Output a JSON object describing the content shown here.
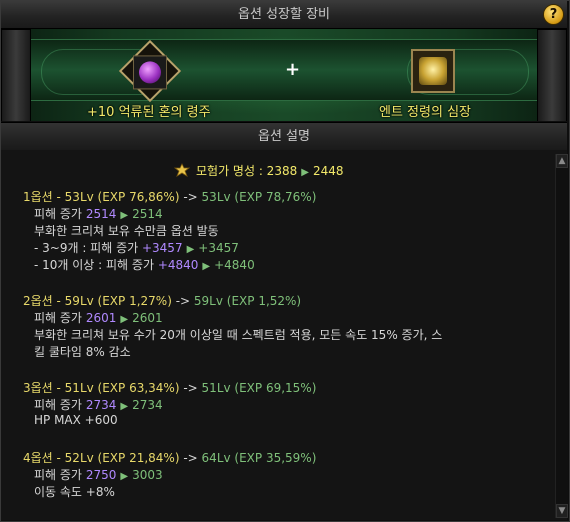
{
  "title": "옵션 성장할 장비",
  "help_label": "?",
  "banner": {
    "left_item": "+10 억류된 혼의 령주",
    "right_item": "엔트 정령의 심장",
    "plus": "+"
  },
  "section_title": "옵션 설명",
  "fame": {
    "label": "모험가 명성 : 2388",
    "to": "2448"
  },
  "options": [
    {
      "header_pre": "1옵션 - 53Lv (EXP 76,86%) ",
      "header_arrow": "->",
      "header_post": " 53Lv (EXP 78,76%)",
      "damage_label": "피해 증가",
      "damage_from": "2514",
      "damage_to": "2514",
      "extra": [
        "부화한 크리쳐 보유 수만큼 옵션 발동",
        "- 3~9개 : 피해 증가 "
      ],
      "sub1_from": "+3457",
      "sub1_to": "+3457",
      "sub2_label": "- 10개 이상 : 피해 증가 ",
      "sub2_from": "+4840",
      "sub2_to": "+4840"
    },
    {
      "header_pre": "2옵션 - 59Lv (EXP 1,27%) ",
      "header_arrow": "->",
      "header_post": " 59Lv (EXP 1,52%)",
      "damage_label": "피해 증가",
      "damage_from": "2601",
      "damage_to": "2601",
      "extra_line1": "부화한 크리쳐 보유 수가 20개 이상일 때 스펙트럼 적용, 모든 속도 15% 증가, 스",
      "extra_line2": "킬 쿨타임 8% 감소"
    },
    {
      "header_pre": "3옵션 - 51Lv (EXP 63,34%) ",
      "header_arrow": "->",
      "header_post": " 51Lv (EXP 69,15%)",
      "damage_label": "피해 증가",
      "damage_from": "2734",
      "damage_to": "2734",
      "extra_line1": "HP MAX +600"
    },
    {
      "header_pre": "4옵션 - 52Lv (EXP 21,84%) ",
      "header_arrow": "->",
      "header_post": " 64Lv (EXP 35,59%)",
      "damage_label": "피해 증가",
      "damage_from": "2750",
      "damage_to": "3003",
      "extra_line1": "이동 속도 +8%"
    }
  ],
  "arrow_glyph": "▶",
  "colors": {
    "accent_yellow": "#e8d96a",
    "green": "#7fc07a",
    "purple": "#b089ff",
    "banner_green": "#1a4a28"
  }
}
